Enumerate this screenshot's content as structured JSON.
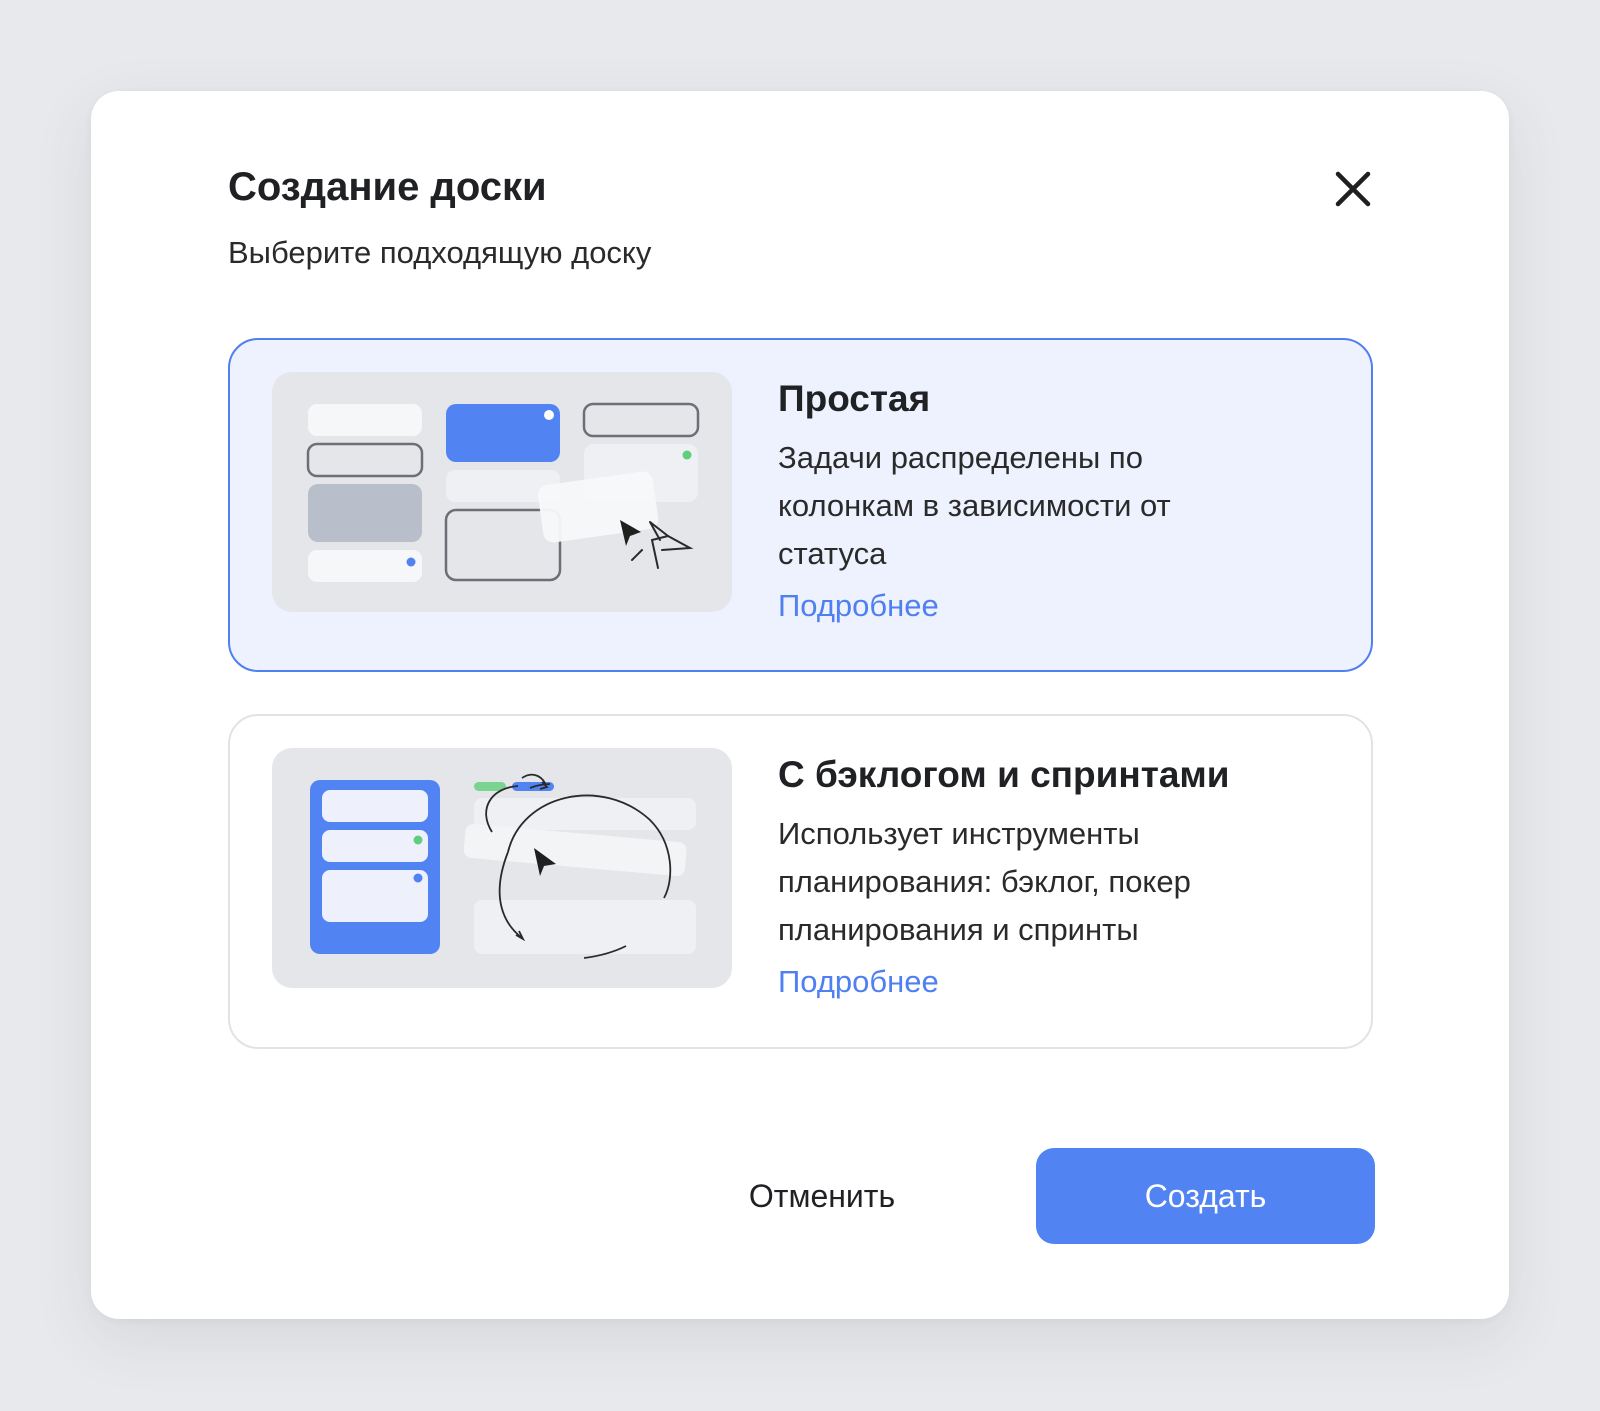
{
  "dialog": {
    "title": "Создание доски",
    "subtitle": "Выберите подходящую доску",
    "close_icon": "close-icon"
  },
  "options": [
    {
      "title": "Простая",
      "description": "Задачи распределены по колонкам в зависимости от статуса",
      "link": "Подробнее",
      "selected": true,
      "illustration": "kanban-board-illustration"
    },
    {
      "title": "С бэклогом и спринтами",
      "description": "Использует инструменты планирования: бэклог, покер планирования и спринты",
      "link": "Подробнее",
      "selected": false,
      "illustration": "sprint-cycle-illustration"
    }
  ],
  "footer": {
    "cancel_label": "Отменить",
    "create_label": "Создать"
  },
  "colors": {
    "accent": "#5283f2",
    "selected_bg": "#edf2fe",
    "selected_border": "#4f7ff0",
    "link": "#4f7ff0",
    "page_bg": "#e8e9ec"
  }
}
